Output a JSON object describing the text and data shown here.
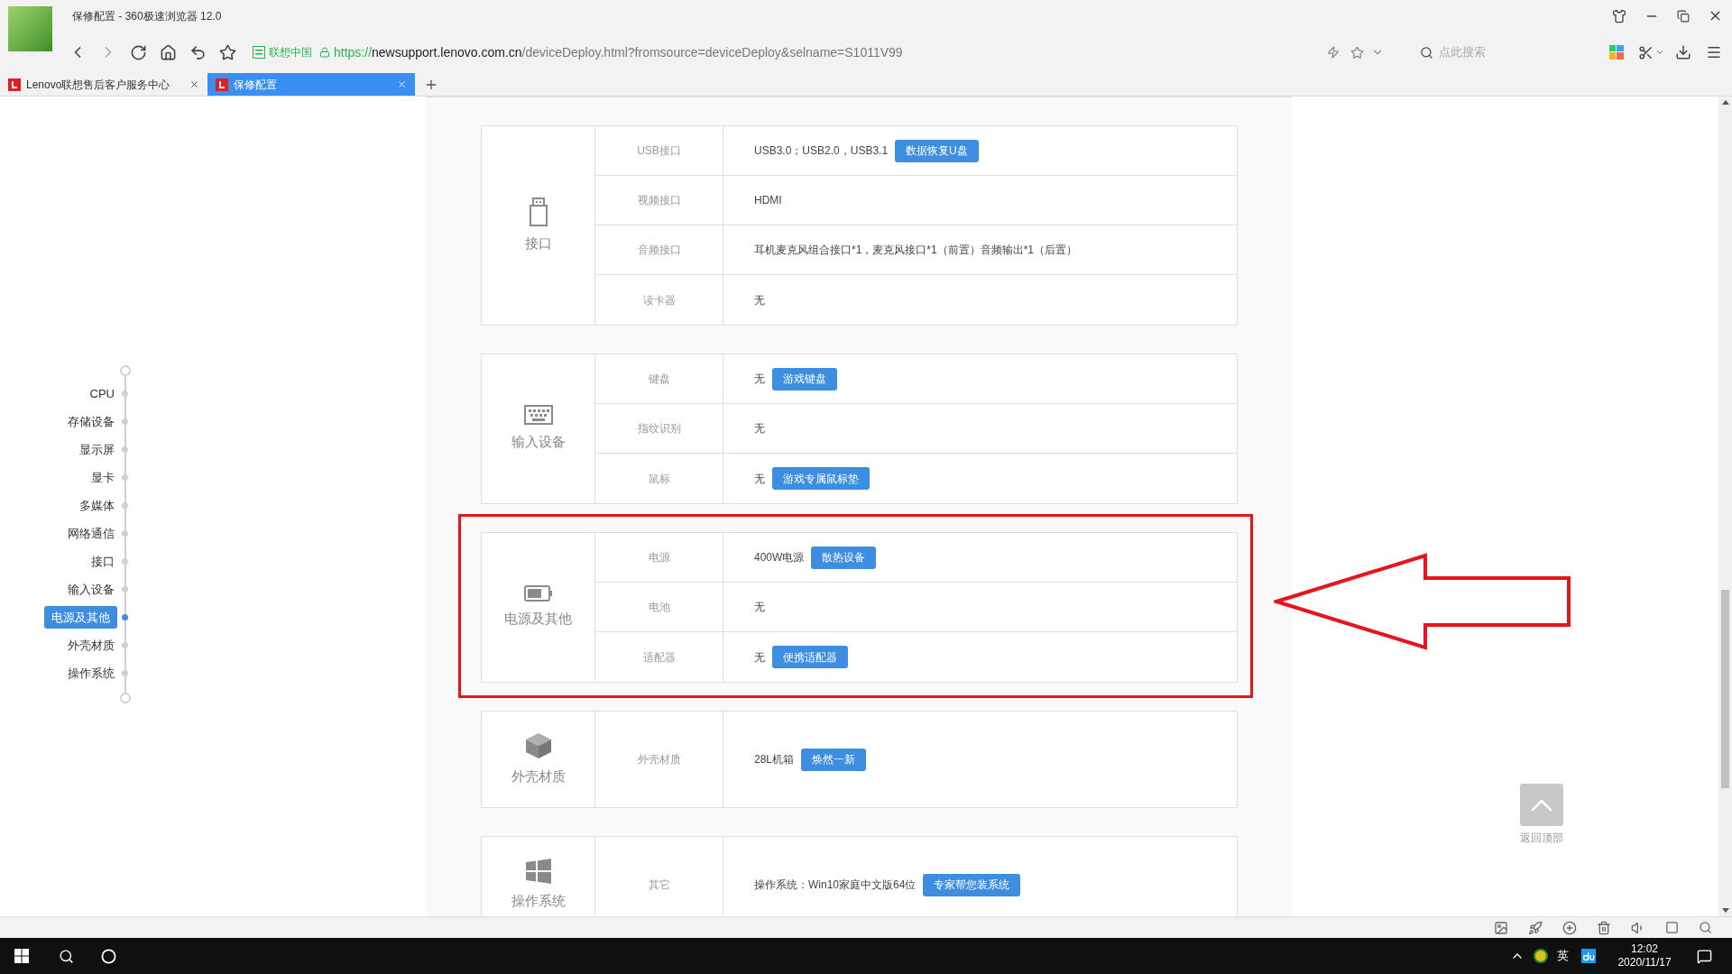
{
  "browser": {
    "title": "保修配置 - 360极速浏览器 12.0",
    "cert_label": "联想中国",
    "url_scheme": "https://",
    "url_host": "newsupport.lenovo.com.cn",
    "url_path": "/deviceDeploy.html?fromsource=deviceDeploy&selname=S1011V99",
    "search_placeholder": "点此搜索"
  },
  "tabs": [
    {
      "label": "Lenovo联想售后客户服务中心",
      "selected": false
    },
    {
      "label": "保修配置",
      "selected": true
    }
  ],
  "sidebar": {
    "items": [
      {
        "label": "CPU",
        "selected": false
      },
      {
        "label": "存储设备",
        "selected": false
      },
      {
        "label": "显示屏",
        "selected": false
      },
      {
        "label": "显卡",
        "selected": false
      },
      {
        "label": "多媒体",
        "selected": false
      },
      {
        "label": "网络通信",
        "selected": false
      },
      {
        "label": "接口",
        "selected": false
      },
      {
        "label": "输入设备",
        "selected": false
      },
      {
        "label": "电源及其他",
        "selected": true
      },
      {
        "label": "外壳材质",
        "selected": false
      },
      {
        "label": "操作系统",
        "selected": false
      }
    ]
  },
  "sections": [
    {
      "kind": "usb",
      "title": "接口",
      "highlighted": false,
      "rows": [
        {
          "label": "USB接口",
          "value": "USB3.0；USB2.0，USB3.1",
          "button": "数据恢复U盘"
        },
        {
          "label": "视频接口",
          "value": "HDMI"
        },
        {
          "label": "音频接口",
          "value": "耳机麦克风组合接口*1，麦克风接口*1（前置）音频输出*1（后置）"
        },
        {
          "label": "读卡器",
          "value": "无"
        }
      ]
    },
    {
      "kind": "keyboard",
      "title": "输入设备",
      "highlighted": false,
      "rows": [
        {
          "label": "键盘",
          "value": "无",
          "button": "游戏键盘"
        },
        {
          "label": "指纹识别",
          "value": "无"
        },
        {
          "label": "鼠标",
          "value": "无",
          "button": "游戏专属鼠标垫"
        }
      ]
    },
    {
      "kind": "battery",
      "title": "电源及其他",
      "highlighted": true,
      "rows": [
        {
          "label": "电源",
          "value": "400W电源",
          "button": "散热设备"
        },
        {
          "label": "电池",
          "value": "无"
        },
        {
          "label": "适配器",
          "value": "无",
          "button": "便携适配器"
        }
      ]
    },
    {
      "kind": "box",
      "title": "外壳材质",
      "highlighted": false,
      "rows": [
        {
          "label": "外壳材质",
          "value": "28L机箱",
          "button": "焕然一新"
        }
      ]
    },
    {
      "kind": "windows",
      "title": "操作系统",
      "highlighted": false,
      "rows": [
        {
          "label": "其它",
          "value": "操作系统：Win10家庭中文版64位",
          "button": "专家帮您装系统"
        }
      ]
    }
  ],
  "back_to_top": {
    "label": "返回顶部"
  },
  "taskbar": {
    "ime": "英",
    "time": "12:02",
    "date": "2020/11/17"
  }
}
